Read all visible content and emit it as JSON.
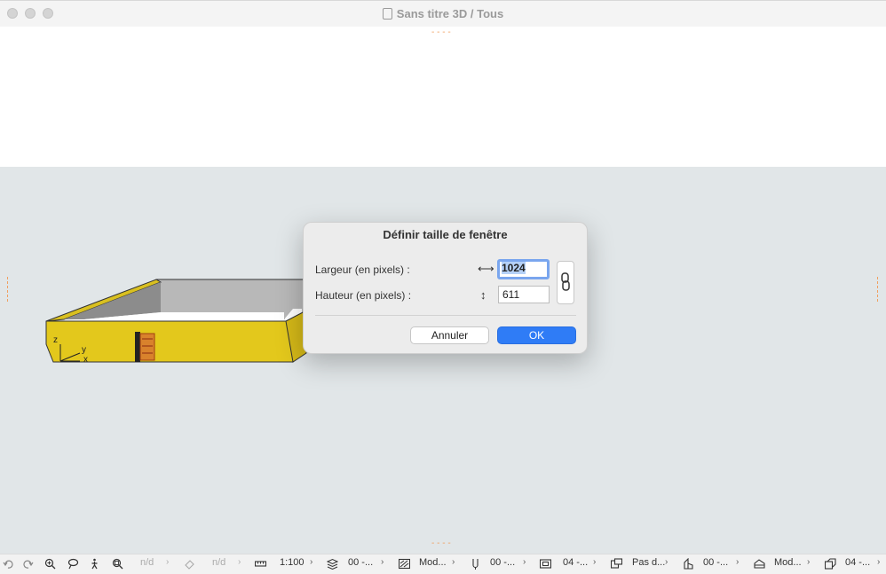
{
  "window": {
    "title": "Sans titre 3D / Tous"
  },
  "dialog": {
    "title": "Définir taille de fenêtre",
    "width_label": "Largeur (en pixels) :",
    "height_label": "Hauteur (en pixels) :",
    "width_value": "1024",
    "height_value": "611",
    "cancel_label": "Annuler",
    "ok_label": "OK"
  },
  "model": {
    "axis_z": "z",
    "axis_y": "y",
    "axis_x": "x",
    "colors": {
      "face": "#e3c81c",
      "inner": "#a9a9a9",
      "floor": "#ffffff"
    }
  },
  "toolbar": {
    "nd1": "n/d",
    "nd2": "n/d",
    "scale": "1:100",
    "layer": "00 -...",
    "mode": "Mod...",
    "pen": "00 -...",
    "view": "04 -...",
    "structure": "Pas d...",
    "renov": "00 -...",
    "model_view": "Mod...",
    "last": "04 -..."
  },
  "colors": {
    "accent": "#2f7cf6",
    "marker": "#f0a060",
    "viewport": "#e1e6e8"
  }
}
